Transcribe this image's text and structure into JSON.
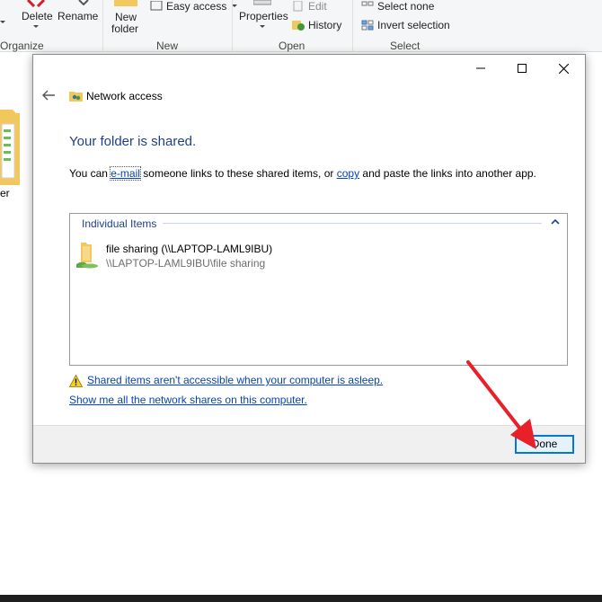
{
  "ribbon": {
    "delete_label": "Delete",
    "rename_label": "Rename",
    "new_folder_label_1": "New",
    "new_folder_label_2": "folder",
    "easy_access_label": "Easy access",
    "properties_label": "Properties",
    "edit_label": "Edit",
    "history_label": "History",
    "select_none_label": "Select none",
    "invert_selection_label": "Invert selection",
    "groups": {
      "organize": "Organize",
      "new": "New",
      "open": "Open",
      "select": "Select"
    }
  },
  "explorer": {
    "partial_item_label": "er"
  },
  "dialog": {
    "title": "Network access",
    "heading": "Your folder is shared.",
    "intro_before": "You can ",
    "email_link": "e-mail",
    "intro_middle": " someone links to these shared items, or ",
    "copy_link": "copy",
    "intro_after": " and paste the links into another app.",
    "group_header": "Individual Items",
    "items": [
      {
        "name": "file sharing (\\\\LAPTOP-LAML9IBU)",
        "path": "\\\\LAPTOP-LAML9IBU\\file sharing"
      }
    ],
    "warning_link": "Shared items aren't accessible when your computer is asleep.",
    "shares_link": "Show me all the network shares on this computer.",
    "done_label": "Done"
  },
  "colors": {
    "heading": "#1e3f8f",
    "link": "#0645ad",
    "accent": "#0078d7",
    "annotation_arrow": "#e8202a"
  }
}
